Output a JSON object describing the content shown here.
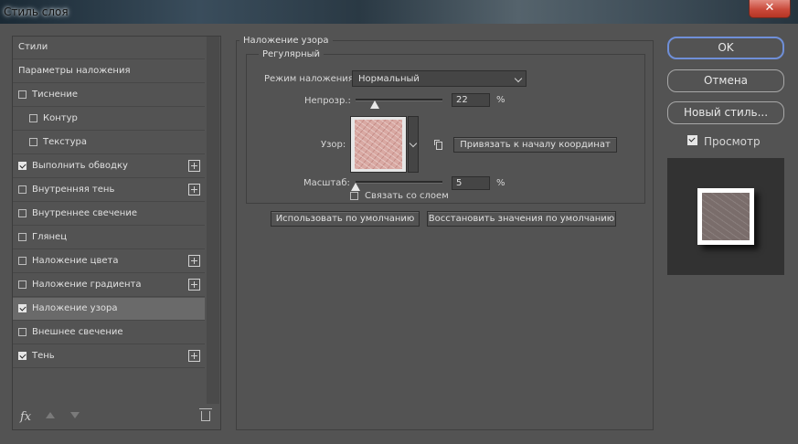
{
  "window": {
    "title": "Стиль слоя",
    "close_label": "✕"
  },
  "left_panel": {
    "items": [
      {
        "label": "Стили",
        "checkbox": false,
        "checked": false,
        "indent": 0,
        "plus": false,
        "selected": false
      },
      {
        "label": "Параметры наложения",
        "checkbox": false,
        "checked": false,
        "indent": 0,
        "plus": false,
        "selected": false
      },
      {
        "label": "Тиснение",
        "checkbox": true,
        "checked": false,
        "indent": 0,
        "plus": false,
        "selected": false
      },
      {
        "label": "Контур",
        "checkbox": true,
        "checked": false,
        "indent": 1,
        "plus": false,
        "selected": false
      },
      {
        "label": "Текстура",
        "checkbox": true,
        "checked": false,
        "indent": 1,
        "plus": false,
        "selected": false
      },
      {
        "label": "Выполнить обводку",
        "checkbox": true,
        "checked": true,
        "indent": 0,
        "plus": true,
        "selected": false
      },
      {
        "label": "Внутренняя тень",
        "checkbox": true,
        "checked": false,
        "indent": 0,
        "plus": true,
        "selected": false
      },
      {
        "label": "Внутреннее свечение",
        "checkbox": true,
        "checked": false,
        "indent": 0,
        "plus": false,
        "selected": false
      },
      {
        "label": "Глянец",
        "checkbox": true,
        "checked": false,
        "indent": 0,
        "plus": false,
        "selected": false
      },
      {
        "label": "Наложение цвета",
        "checkbox": true,
        "checked": false,
        "indent": 0,
        "plus": true,
        "selected": false
      },
      {
        "label": "Наложение градиента",
        "checkbox": true,
        "checked": false,
        "indent": 0,
        "plus": true,
        "selected": false
      },
      {
        "label": "Наложение узора",
        "checkbox": true,
        "checked": true,
        "indent": 0,
        "plus": false,
        "selected": true
      },
      {
        "label": "Внешнее свечение",
        "checkbox": true,
        "checked": false,
        "indent": 0,
        "plus": false,
        "selected": false
      },
      {
        "label": "Тень",
        "checkbox": true,
        "checked": true,
        "indent": 0,
        "plus": true,
        "selected": false
      }
    ],
    "fx_label": "fx"
  },
  "pattern_overlay": {
    "group_title": "Наложение узора",
    "subgroup_title": "Регулярный",
    "blend_mode_label": "Режим наложения:",
    "blend_mode_value": "Нормальный",
    "opacity_label": "Непрозр.:",
    "opacity_value": "22",
    "opacity_fraction": 0.22,
    "pattern_label": "Узор:",
    "snap_button": "Привязать к началу координат",
    "scale_label": "Масштаб:",
    "scale_value": "5",
    "scale_fraction": 0.0,
    "percent": "%",
    "link_label": "Связать со слоем",
    "link_checked": false,
    "default_button": "Использовать по умолчанию",
    "reset_button": "Восстановить значения по умолчанию"
  },
  "right_panel": {
    "ok": "OK",
    "cancel": "Отмена",
    "new_style": "Новый стиль...",
    "preview_label": "Просмотр",
    "preview_checked": true
  },
  "colors": {
    "background": "#535353",
    "selected_row": "#6a6a6a",
    "ok_border": "#6f8fd8",
    "pattern": "#d9a9a3"
  }
}
